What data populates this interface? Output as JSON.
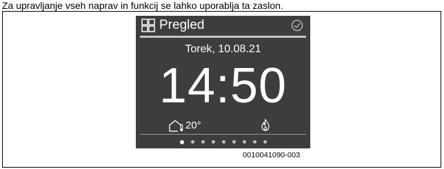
{
  "caption": "Za upravljanje vseh naprav in funkcij se lahko uporablja ta zaslon.",
  "screen": {
    "header": {
      "title": "Pregled",
      "icon": "overview-grid-icon",
      "status_icon": "check-circle-icon"
    },
    "date": "Torek, 10.08.21",
    "time": "14:50",
    "indoor_temperature": "20°",
    "flame_icon": "flame-icon",
    "page_indicator": {
      "total": 9,
      "active_index": 0
    },
    "colors": {
      "background": "#3d3d3d",
      "text": "#ffffff",
      "rule": "#c8c8c8"
    }
  },
  "figure_code": "0010041090-003"
}
